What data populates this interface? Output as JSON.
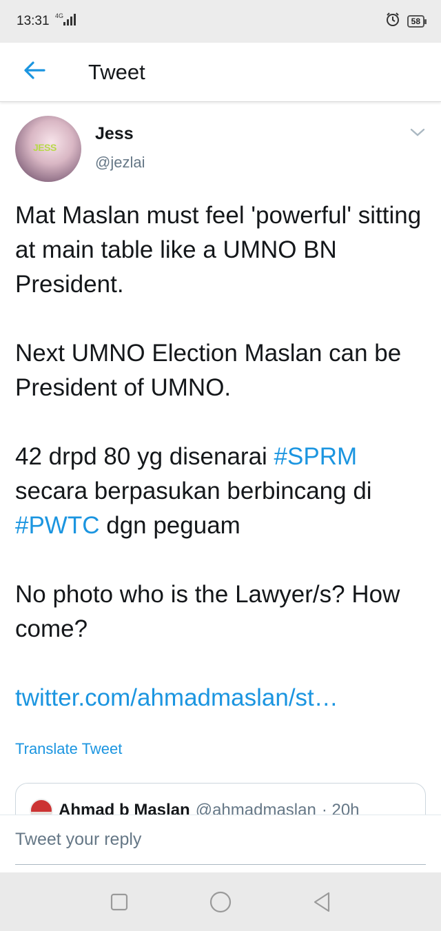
{
  "status_bar": {
    "time": "13:31",
    "network": "4G",
    "battery": "58"
  },
  "header": {
    "title": "Tweet"
  },
  "tweet": {
    "author_name": "Jess",
    "author_handle": "@jezlai",
    "avatar_text": "JESS",
    "paragraphs": {
      "p1": "Mat Maslan must feel 'powerful' sitting at main table like a UMNO BN President.",
      "p2": "Next UMNO Election Maslan can be President of UMNO.",
      "p3_start": "42 drpd 80 yg disenarai ",
      "p3_hashtag1": "#SPRM",
      "p3_mid": " secara berpasukan berbincang di ",
      "p3_hashtag2": "#PWTC",
      "p3_end": " dgn peguam",
      "p4": "No photo who is the Lawyer/s? How come?"
    },
    "link": "twitter.com/ahmadmaslan/st…",
    "translate_label": "Translate Tweet"
  },
  "quoted_tweet": {
    "name": "Ahmad b Maslan",
    "handle": "@ahmadmaslan",
    "time": "· 20h"
  },
  "reply": {
    "placeholder": "Tweet your reply"
  },
  "colors": {
    "link_blue": "#1b95e0",
    "text_primary": "#14171a",
    "text_secondary": "#657786"
  }
}
